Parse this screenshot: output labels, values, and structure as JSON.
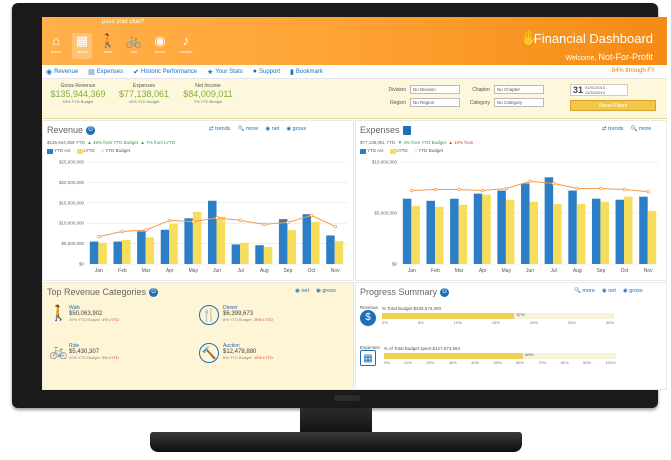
{
  "header": {
    "tagline": "pass your clue?",
    "title": "Financial Dashboard",
    "welcome_prefix": "Welcome,",
    "welcome_name": "Not-For-Profit",
    "nav": [
      {
        "icon": "⌂",
        "label": "home",
        "name": "home-icon"
      },
      {
        "icon": "▦",
        "label": "report",
        "name": "calculator-icon"
      },
      {
        "icon": "🚶",
        "label": "walk",
        "name": "walk-icon"
      },
      {
        "icon": "🚲",
        "label": "ride",
        "name": "bike-icon"
      },
      {
        "icon": "◉",
        "label": "dinner",
        "name": "dinner-icon"
      },
      {
        "icon": "♪",
        "label": "auction",
        "name": "auction-icon"
      }
    ]
  },
  "menu": {
    "items": [
      {
        "icon": "◉",
        "label": "Revenue"
      },
      {
        "icon": "▤",
        "label": "Expenses"
      },
      {
        "icon": "✔",
        "label": "Historic Performance"
      },
      {
        "icon": "★",
        "label": "Your Stats"
      },
      {
        "icon": "●",
        "label": "Support"
      },
      {
        "icon": "▮",
        "label": "Bookmark"
      }
    ],
    "period": "84% through FY"
  },
  "summary": {
    "gross_label": "Gross Revenue",
    "gross_value": "$135,944,369",
    "gross_sub": "44% FYD Budget",
    "exp_label": "Expenses",
    "exp_value": "$77,138,061",
    "exp_sub": "43% YTD budget",
    "net_label": "Net Income",
    "net_value": "$84,009,011",
    "net_sub": "7% YTD Budget",
    "division_label": "Division",
    "division_value": "No Division",
    "region_label": "Region",
    "region_value": "No Region",
    "chapter_label": "Chapter",
    "chapter_value": "No Chapter",
    "category_label": "Category",
    "category_value": "No Category",
    "calendar_day": "31",
    "calendar_range": "01/01/2013 - 11/30/2013",
    "reset_label": "Reset Filters"
  },
  "revenue_panel": {
    "title": "Revenue",
    "links": [
      "trends",
      "more",
      "net",
      "gross"
    ],
    "meta_total": "$135,944,369 YTD",
    "meta_budget": "45% from YTD Budget",
    "meta_ytd": "7% from LYTD",
    "legend": [
      "YTD Act",
      "LYTD",
      "YTD Budget"
    ]
  },
  "expenses_panel": {
    "title": "Expenses",
    "links": [
      "trends",
      "more"
    ],
    "meta_total": "$77,138,061 YTD",
    "meta_budget": "4% from YTD Budget",
    "meta_ytd": "10% from",
    "legend": [
      "YTD Act",
      "LYTD",
      "YTD Budget"
    ]
  },
  "categories_panel": {
    "title": "Top Revenue Categories",
    "links": [
      "net",
      "gross"
    ],
    "items": [
      {
        "icon": "🚶",
        "icon_name": "walk-icon",
        "name": "Walk",
        "value": "$50,063,902",
        "sub1": "49% YTD Budget",
        "sub2": "4% LYTD"
      },
      {
        "icon": "🍴",
        "icon_name": "dinner-icon",
        "name": "Dinner",
        "value": "$6,399,673",
        "sub1": "8% YTD Budget",
        "sub2": "20% LYTD"
      },
      {
        "icon": "🚲",
        "icon_name": "bike-icon",
        "name": "Ride",
        "value": "$5,430,307",
        "sub1": "40% YTD Budget",
        "sub2": "9% LYTD"
      },
      {
        "icon": "🔨",
        "icon_name": "auction-icon",
        "name": "Auction",
        "value": "$12,478,880",
        "sub1": "6% YTD Budget",
        "sub2": "12% LYTD"
      }
    ]
  },
  "progress_panel": {
    "title": "Progress Summary",
    "links": [
      "more",
      "net",
      "gross"
    ],
    "revenue_label": "Revenue",
    "revenue_caption": "% Total Budget $235,673,300",
    "revenue_pct": 0.57,
    "revenue_pct_label": "57%",
    "expenses_label": "Expenses",
    "expenses_caption": "% of Total Budget spent $127,673,594",
    "expenses_pct": 0.6,
    "expenses_pct_label": "60%",
    "ticks": [
      "0%",
      "5%",
      "10%",
      "15%",
      "20%",
      "25%",
      "30%"
    ],
    "expenses_ticks": [
      "0%",
      "10%",
      "20%",
      "30%",
      "40%",
      "50%",
      "60%",
      "70%",
      "80%",
      "90%",
      "100%"
    ]
  },
  "colors": {
    "header_orange": "#ffa436",
    "blue": "#1d6fb8",
    "yellow": "#f6dd5c",
    "budget_line": "#f19a4a",
    "green": "#7ab52e"
  },
  "chart_data": [
    {
      "type": "bar",
      "title": "Revenue",
      "categories": [
        "Jan",
        "Feb",
        "Mar",
        "Apr",
        "May",
        "Jun",
        "Jul",
        "Aug",
        "Sep",
        "Oct",
        "Nov"
      ],
      "yticks": [
        "$0",
        "$5,000,000",
        "$10,000,000",
        "$15,000,000",
        "$20,000,000",
        "$25,000,000"
      ],
      "ylim": [
        0,
        25000000
      ],
      "series": [
        {
          "name": "YTD Act",
          "kind": "bar",
          "color": "#2c7fc6",
          "values": [
            5500000,
            5500000,
            8000000,
            8400000,
            11200000,
            15500000,
            4800000,
            4600000,
            11000000,
            12200000,
            7000000
          ]
        },
        {
          "name": "LYTD",
          "kind": "bar",
          "color": "#f6dd5c",
          "values": [
            5200000,
            5900000,
            6500000,
            9800000,
            12800000,
            11600000,
            5200000,
            4200000,
            8300000,
            10300000,
            5600000
          ]
        },
        {
          "name": "YTD Budget",
          "kind": "line",
          "color": "#f19a4a",
          "values": [
            6700000,
            8000000,
            8300000,
            10700000,
            10400000,
            11300000,
            10700000,
            9700000,
            10200000,
            11900000,
            9200000
          ]
        }
      ]
    },
    {
      "type": "bar",
      "title": "Expenses",
      "categories": [
        "Jan",
        "Feb",
        "Mar",
        "Apr",
        "May",
        "Jun",
        "Jul",
        "Aug",
        "Sep",
        "Oct",
        "Nov"
      ],
      "yticks": [
        "$0",
        "$5,000,000",
        "$10,000,000"
      ],
      "ylim": [
        0,
        10000000
      ],
      "series": [
        {
          "name": "YTD Act",
          "kind": "bar",
          "color": "#2c7fc6",
          "values": [
            6400000,
            6200000,
            6400000,
            6900000,
            7200000,
            7900000,
            8500000,
            7200000,
            6400000,
            6300000,
            6600000
          ]
        },
        {
          "name": "LYTD",
          "kind": "bar",
          "color": "#f6dd5c",
          "values": [
            5700000,
            5600000,
            5800000,
            6800000,
            6300000,
            6100000,
            5900000,
            5900000,
            6100000,
            6600000,
            5200000
          ]
        },
        {
          "name": "YTD Budget",
          "kind": "line",
          "color": "#f19a4a",
          "values": [
            7200000,
            7300000,
            7300000,
            7200000,
            7400000,
            8100000,
            7900000,
            7400000,
            7400000,
            7300000,
            7100000
          ]
        }
      ]
    }
  ]
}
